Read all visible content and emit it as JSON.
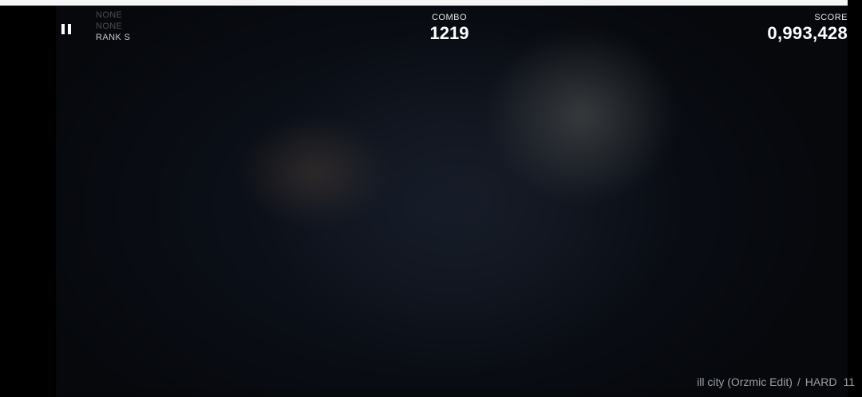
{
  "progress": {
    "fraction": 0.983,
    "color": "#f5f5f5"
  },
  "pause": {
    "icon": "pause-icon"
  },
  "judgement": {
    "line1": "NONE",
    "line2": "NONE",
    "rank": "RANK S"
  },
  "combo": {
    "label": "COMBO",
    "value": "1219"
  },
  "score": {
    "label": "SCORE",
    "value": "0,993,428"
  },
  "song": {
    "title": "ill city (Orzmic Edit)",
    "separator": "/",
    "difficulty": "HARD",
    "level": "11"
  }
}
